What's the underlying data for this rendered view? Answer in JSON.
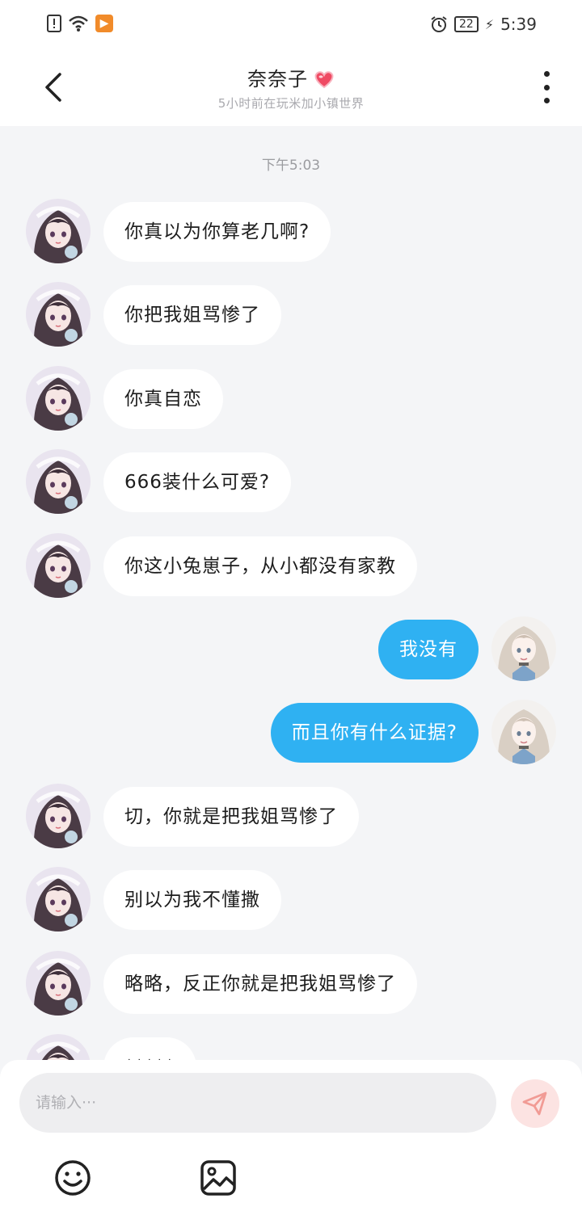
{
  "status_bar": {
    "alarm_icon": "alarm-icon",
    "battery": "22",
    "time": "5:39"
  },
  "header": {
    "title": "奈奈子",
    "subtitle": "5小时前在玩米加小镇世界"
  },
  "chat": {
    "timestamp": "下午5:03",
    "messages": [
      {
        "side": "left",
        "text": "你真以为你算老几啊?"
      },
      {
        "side": "left",
        "text": "你把我姐骂惨了"
      },
      {
        "side": "left",
        "text": "你真自恋"
      },
      {
        "side": "left",
        "text": "666装什么可爱?"
      },
      {
        "side": "left",
        "text": "你这小兔崽子，从小都没有家教"
      },
      {
        "side": "right",
        "text": "我没有"
      },
      {
        "side": "right",
        "text": "而且你有什么证据?"
      },
      {
        "side": "left",
        "text": "切，你就是把我姐骂惨了"
      },
      {
        "side": "left",
        "text": "别以为我不懂撒"
      },
      {
        "side": "left",
        "text": "略略，反正你就是把我姐骂惨了"
      },
      {
        "side": "left",
        "text": "*****"
      }
    ]
  },
  "input": {
    "placeholder": "请输入···"
  },
  "colors": {
    "accent_blue": "#2fb1f2",
    "send_button_bg": "#fce3e2",
    "send_arrow": "#f19b95",
    "background": "#f4f5f7"
  }
}
